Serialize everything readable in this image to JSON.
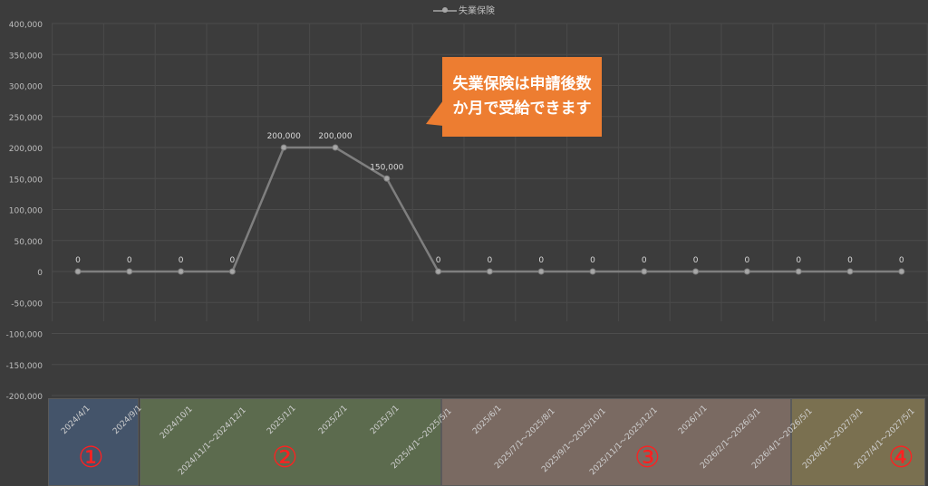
{
  "legend": {
    "label": "失業保険"
  },
  "callout": {
    "text": "失業保険は申請後数か月で受給できます"
  },
  "bands": [
    {
      "number": "①",
      "color": "#44546a"
    },
    {
      "number": "②",
      "color": "#5c6b4e"
    },
    {
      "number": "③",
      "color": "#7a6a62"
    },
    {
      "number": "④",
      "color": "#7a7050"
    }
  ],
  "chart_data": {
    "type": "line",
    "categories": [
      "2024/4/1",
      "2024/9/1",
      "2024/10/1",
      "2024/11/1～2024/12/1",
      "2025/1/1",
      "2025/2/1",
      "2025/3/1",
      "2025/4/1～2025/5/1",
      "2025/6/1",
      "2025/7/1～2025/8/1",
      "2025/9/1～2025/10/1",
      "2025/11/1～2025/12/1",
      "2026/1/1",
      "2026/2/1～2026/3/1",
      "2026/4/1～2026/5/1",
      "2026/6/1～2027/3/1",
      "2027/4/1～2027/5/1"
    ],
    "series": [
      {
        "name": "失業保険",
        "values": [
          0,
          0,
          0,
          0,
          200000,
          200000,
          150000,
          0,
          0,
          0,
          0,
          0,
          0,
          0,
          0,
          0,
          0
        ]
      }
    ],
    "data_labels": [
      "0",
      "0",
      "0",
      "0",
      "200,000",
      "200,000",
      "150,000",
      "0",
      "0",
      "0",
      "0",
      "0",
      "0",
      "0",
      "0",
      "0",
      "0"
    ],
    "ylim": [
      -200000,
      400000
    ],
    "yticks": [
      400000,
      350000,
      300000,
      250000,
      200000,
      150000,
      100000,
      50000,
      0,
      -50000,
      -100000,
      -150000,
      -200000
    ],
    "ytick_labels": [
      "400,000",
      "350,000",
      "300,000",
      "250,000",
      "200,000",
      "150,000",
      "100,000",
      "50,000",
      "0",
      "-50,000",
      "-100,000",
      "-150,000",
      "-200,000"
    ],
    "grid": true,
    "legend_position": "top"
  }
}
